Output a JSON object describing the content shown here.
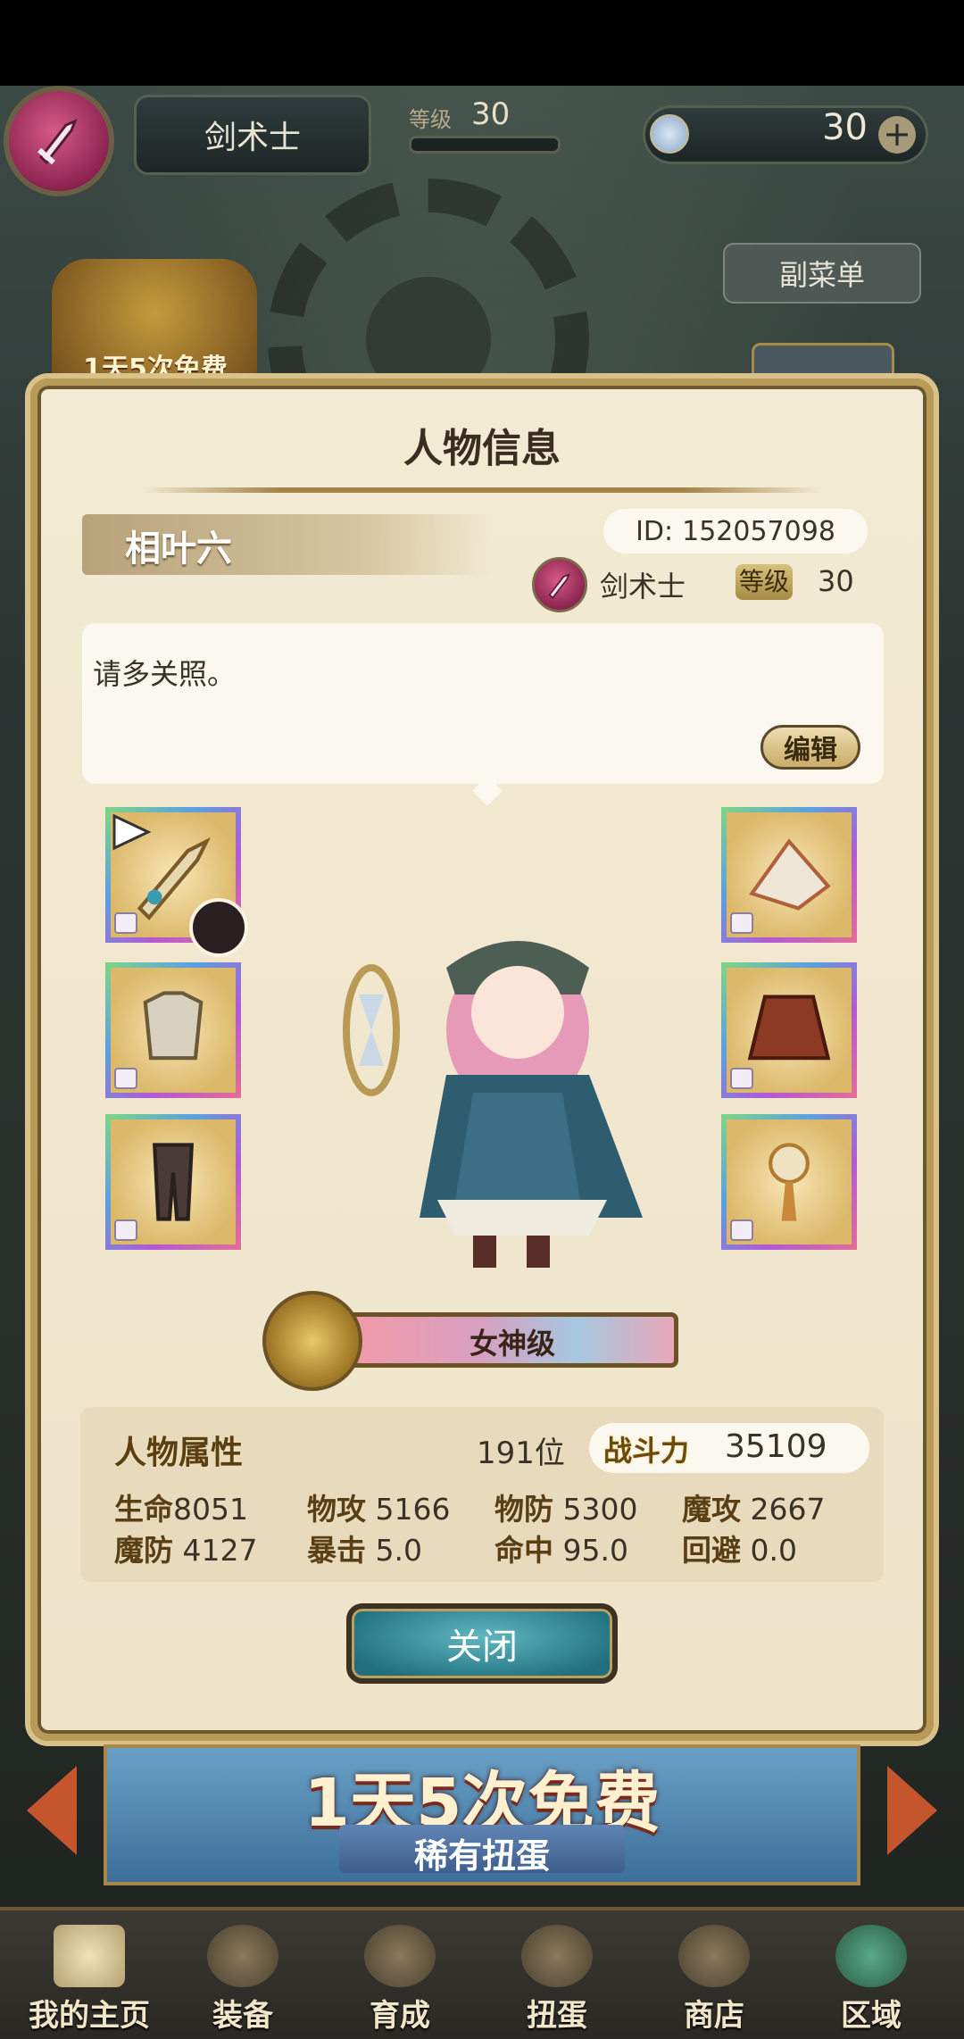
{
  "hud": {
    "class_name": "剑术士",
    "level_label": "等级",
    "level_value": "30",
    "gem_count": "30",
    "plus": "+"
  },
  "submenu_label": "副菜单",
  "left_promo": "1天5次免费",
  "modal": {
    "title": "人物信息",
    "player_name": "相叶六",
    "id_label": "ID:",
    "id_value": "152057098",
    "class_name": "剑术士",
    "level_label": "等级",
    "level_value": "30",
    "bio": "请多关照。",
    "edit_label": "编辑",
    "equipment": {
      "left": [
        "sword-icon",
        "armor-icon",
        "greaves-icon"
      ],
      "right": [
        "shield-icon",
        "cape-icon",
        "amulet-icon"
      ]
    },
    "rank_label": "女神级",
    "stats": {
      "title": "人物属性",
      "rank_position": "191位",
      "power_label": "战斗力",
      "power_value": "35109",
      "items": [
        {
          "key": "生命",
          "value": "8051"
        },
        {
          "key": "物攻",
          "value": "5166"
        },
        {
          "key": "物防",
          "value": "5300"
        },
        {
          "key": "魔攻",
          "value": "2667"
        },
        {
          "key": "魔防",
          "value": "4127"
        },
        {
          "key": "暴击",
          "value": "5.0"
        },
        {
          "key": "命中",
          "value": "95.0"
        },
        {
          "key": "回避",
          "value": "0.0"
        }
      ]
    },
    "close_label": "关闭"
  },
  "banner": {
    "title": "1天5次免费",
    "subtitle": "稀有扭蛋"
  },
  "nav": {
    "items": [
      {
        "label": "我的主页",
        "icon": "home-scroll-icon"
      },
      {
        "label": "装备",
        "icon": "helmet-icon"
      },
      {
        "label": "育成",
        "icon": "crossed-swords-icon"
      },
      {
        "label": "扭蛋",
        "icon": "gacha-machine-icon"
      },
      {
        "label": "商店",
        "icon": "shop-bag-icon"
      },
      {
        "label": "区域",
        "icon": "globe-icon"
      }
    ]
  },
  "colors": {
    "modal_bg": "#f3ead3",
    "gold_border": "#b99b58",
    "class_badge": "#b03a6a",
    "close_btn": "#2f8a96"
  }
}
